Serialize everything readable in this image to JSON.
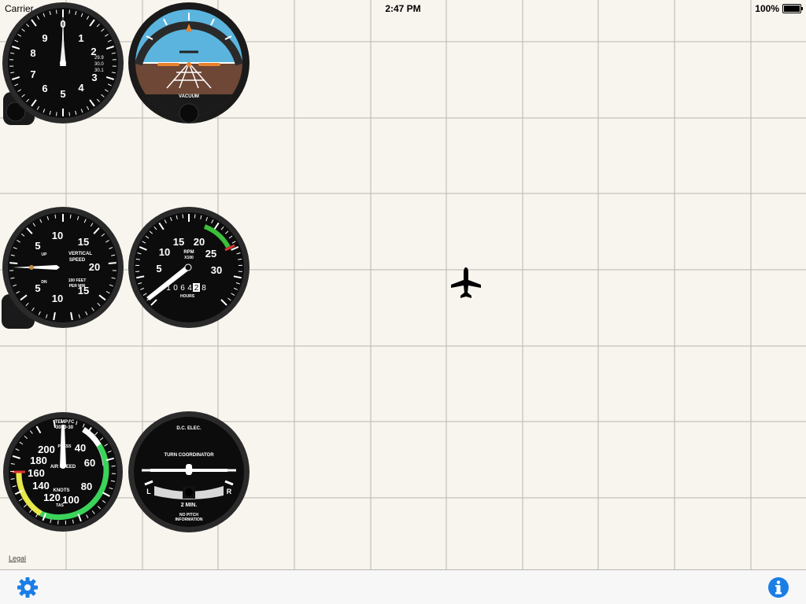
{
  "status_bar": {
    "carrier": "Carrier",
    "time": "2:47 PM",
    "battery": "100%"
  },
  "altimeter": {
    "numbers": [
      "0",
      "1",
      "2",
      "3",
      "4",
      "5",
      "6",
      "7",
      "8",
      "9"
    ],
    "kollsman": [
      "29.9",
      "30.0",
      "30.1"
    ]
  },
  "attitude": {
    "label": "VACUUM"
  },
  "vsi": {
    "title_1": "VERTICAL",
    "title_2": "SPEED",
    "sub_1": "100 FEET",
    "sub_2": "PER MIN",
    "up": "UP",
    "dn": "DN",
    "numbers": [
      "5",
      "10",
      "15",
      "20",
      "15",
      "10",
      "5"
    ]
  },
  "tach": {
    "title": "RPM",
    "sub": "X100",
    "hours_label": "HOURS",
    "odometer": [
      "1",
      "0",
      "6",
      "4",
      "2",
      "8"
    ],
    "numbers": [
      "5",
      "10",
      "15",
      "20",
      "25",
      "30"
    ]
  },
  "airspeed": {
    "temp": "TEMP °C",
    "temp_scale": "30+0-30",
    "knots": "KNOTS",
    "label": "AIR SPEED",
    "tas": "TAS",
    "press": "PRESS",
    "numbers": [
      "40",
      "60",
      "80",
      "100",
      "120",
      "140",
      "160",
      "180",
      "200"
    ]
  },
  "turn": {
    "top": "D.C.  ELEC.",
    "title": "TURN  COORDINATOR",
    "left": "L",
    "right": "R",
    "min": "2 MIN.",
    "note_1": "NO  PITCH",
    "note_2": "INFORMATION"
  },
  "legal": "Legal",
  "colors": {
    "accent": "#1a7ee6",
    "grid": "#b9b6b0",
    "background": "#f8f4ee"
  },
  "icons": {
    "settings": "gear-icon",
    "info": "info-icon",
    "airplane": "airplane-icon"
  }
}
